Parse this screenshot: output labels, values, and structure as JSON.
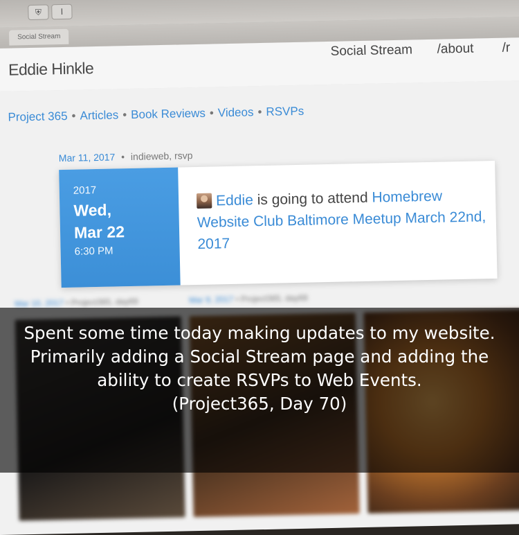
{
  "browser": {
    "tab_title": "Social Stream",
    "toolbar_icons": [
      "shield-icon",
      "text-cursor-icon"
    ]
  },
  "site": {
    "title": "Eddie Hinkle",
    "nav": [
      "Social Stream",
      "/about",
      "/r"
    ]
  },
  "categories": [
    "Project 365",
    "Articles",
    "Book Reviews",
    "Videos",
    "RSVPs"
  ],
  "post": {
    "date": "Mar 11, 2017",
    "separator": "•",
    "tags": "indieweb, rsvp",
    "event": {
      "year": "2017",
      "weekday": "Wed,",
      "month_day": "Mar 22",
      "time": "6:30 PM"
    },
    "author": "Eddie",
    "action": " is going to attend ",
    "event_name": "Homebrew Website Club Baltimore Meetup March 22nd, 2017"
  },
  "feed": [
    {
      "date": "Mar 10, 2017",
      "tags": "Project365, day69"
    },
    {
      "date": "Mar 9, 2017",
      "tags": "Project365, day68"
    }
  ],
  "caption": {
    "text": "Spent some time today making updates to my website. Primarily adding a Social Stream page and adding the ability to create RSVPs to Web Events.",
    "sub": "(Project365, Day 70)"
  },
  "colors": {
    "link": "#3a8bd6",
    "event_card": "#4a9de3"
  }
}
